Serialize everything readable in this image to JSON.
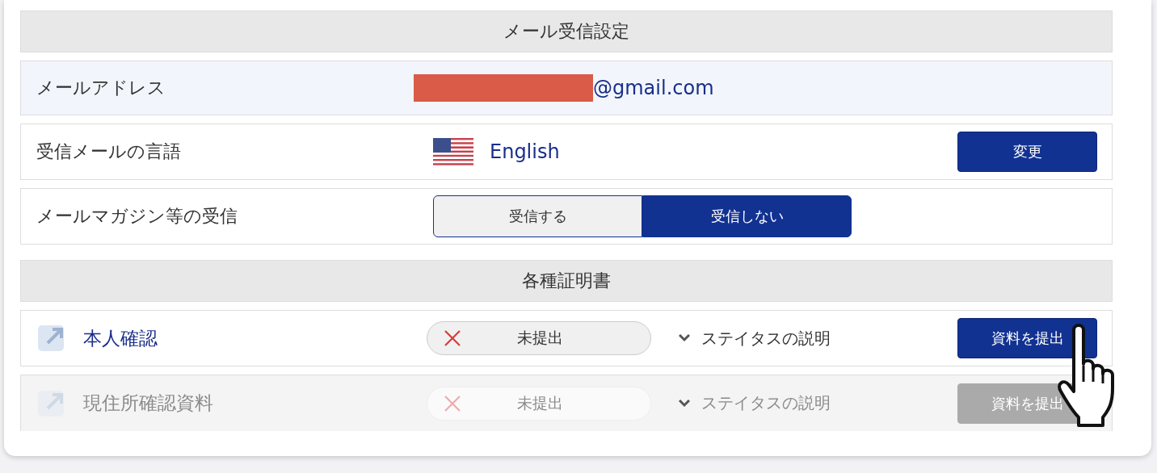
{
  "mail_settings": {
    "title": "メール受信設定",
    "email": {
      "label": "メールアドレス",
      "value": "@gmail.com",
      "redacted": true
    },
    "language": {
      "label": "受信メールの言語",
      "value": "English",
      "button": "変更"
    },
    "newsletter": {
      "label": "メールマガジン等の受信",
      "options": [
        {
          "label": "受信する",
          "selected": false
        },
        {
          "label": "受信しない",
          "selected": true
        }
      ]
    }
  },
  "certificates": {
    "title": "各種証明書",
    "items": [
      {
        "name": "本人確認",
        "status": "未提出",
        "status_help": "ステイタスの説明",
        "button": "資料を提出",
        "disabled": false
      },
      {
        "name": "現住所確認資料",
        "status": "未提出",
        "status_help": "ステイタスの説明",
        "button": "資料を提出",
        "disabled": true
      }
    ]
  }
}
